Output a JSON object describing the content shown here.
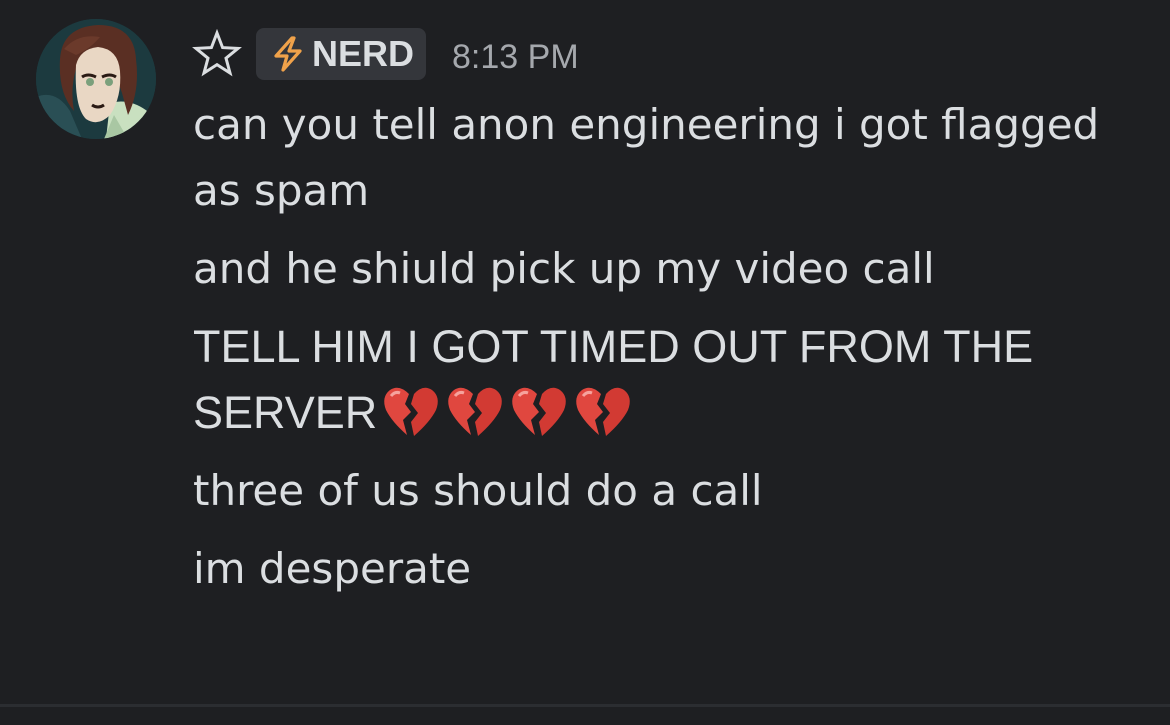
{
  "message_group": {
    "author_tag": "NERD",
    "timestamp": "8:13 PM",
    "icons": {
      "favorite": "star-outline-icon",
      "tag_badge": "lightning-bolt-icon",
      "reaction_emoji": "broken-heart-emoji"
    },
    "colors": {
      "background": "#1e1f22",
      "text": "#dbdee1",
      "tag_background": "#34363b",
      "bolt": "#f0a24a",
      "timestamp": "#a5a8ad"
    },
    "messages": [
      "can you tell anon engineering i got flagged as spam",
      "and he shiuld pick up my video call",
      "TELL HIM I GOT TIMED OUT FROM THE SERVER",
      "three of us should do a call",
      "im desperate"
    ],
    "broken_heart_count": 4
  }
}
